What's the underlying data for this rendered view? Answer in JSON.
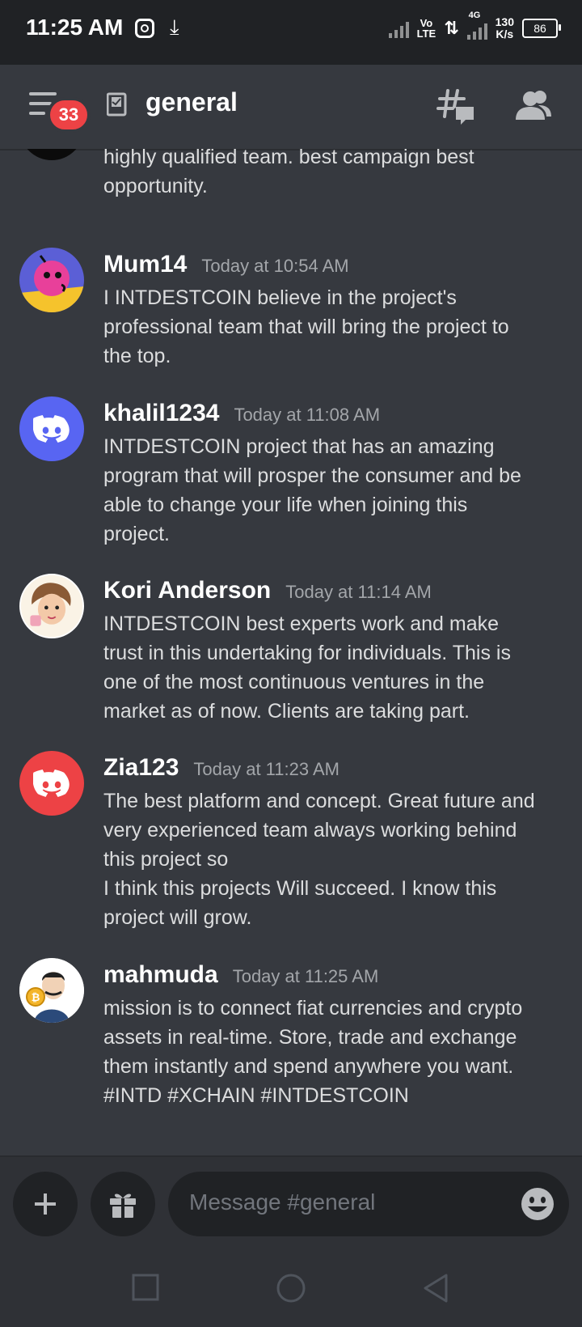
{
  "status_bar": {
    "time": "11:25 AM",
    "network_top": "Vo",
    "network_bottom": "LTE",
    "gen": "4G",
    "speed_value": "130",
    "speed_unit": "K/s",
    "battery": "86"
  },
  "header": {
    "notification_count": "33",
    "channel_name": "general"
  },
  "messages": [
    {
      "username": "",
      "timestamp": "",
      "text": "This project supported by experienced and\nhighly qualified team. best campaign best\nopportunity."
    },
    {
      "username": "Mum14",
      "timestamp": "Today at 10:54 AM",
      "text": "I  INTDESTCOIN believe in the project's\nprofessional team that will bring the project to\nthe top."
    },
    {
      "username": "khalil1234",
      "timestamp": "Today at 11:08 AM",
      "text": "INTDESTCOIN project that has an amazing\nprogram that will prosper the consumer and be\nable to change your life when joining this\nproject."
    },
    {
      "username": "Kori Anderson",
      "timestamp": "Today at 11:14 AM",
      "text": "INTDESTCOIN best experts work and make\ntrust in this undertaking for individuals. This is\none of the most continuous ventures in the\nmarket as of now. Clients are taking part."
    },
    {
      "username": "Zia123",
      "timestamp": "Today at 11:23 AM",
      "text": "The best platform and concept. Great future and\nvery experienced team always working behind\nthis project so\nI think this projects Will succeed. I know this\nproject will grow."
    },
    {
      "username": "mahmuda",
      "timestamp": "Today at 11:25 AM",
      "text": "mission is to connect fiat currencies and crypto\nassets in real-time. Store, trade and exchange\nthem instantly and spend anywhere you want.\n#INTD #XCHAIN   #INTDESTCOIN"
    }
  ],
  "composer": {
    "placeholder": "Message #general"
  },
  "colors": {
    "background": "#36393f",
    "discord_blue": "#5865f2",
    "discord_red": "#ed4245",
    "badge": "#ed4245"
  }
}
